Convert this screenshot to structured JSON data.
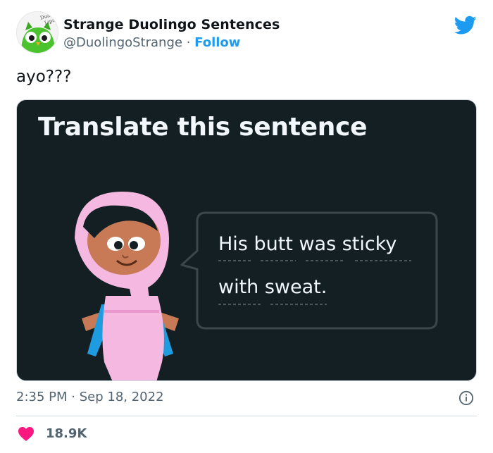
{
  "account": {
    "display_name": "Strange Duolingo Sentences",
    "handle": "@DuolingoStrange",
    "separator": "·",
    "follow_label": "Follow",
    "avatar_icon": "duolingo-owl-icon",
    "avatar_text": "Dua Lipa"
  },
  "platform_icon": "twitter-bird-icon",
  "tweet": {
    "text": "ayo???"
  },
  "media": {
    "title": "Translate this sentence",
    "sentence_line1": "His butt was sticky",
    "sentence_line2": "with sweat.",
    "background_color": "#141f23"
  },
  "meta": {
    "time": "2:35 PM",
    "separator": "·",
    "date": "Sep 18, 2022",
    "info_icon": "info-icon"
  },
  "engagement": {
    "like_icon": "heart-icon",
    "like_count": "18.9K",
    "like_color": "#f91880"
  },
  "colors": {
    "twitter_blue": "#1d9bf0",
    "secondary_text": "#536471"
  }
}
